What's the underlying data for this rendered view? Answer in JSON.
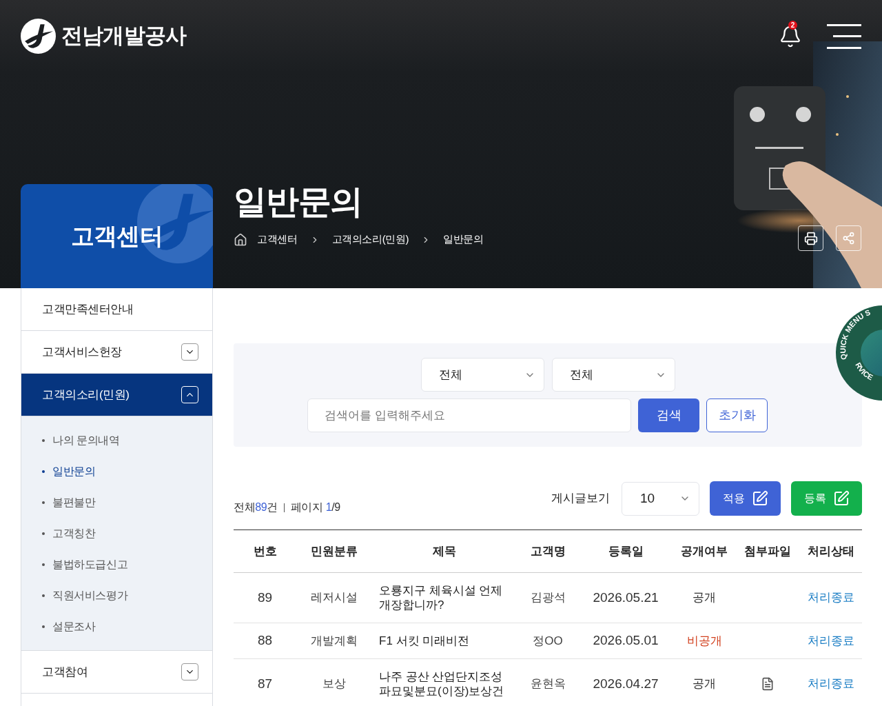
{
  "header": {
    "logo_text": "전남개발공사",
    "notification_count": "2"
  },
  "hero": {
    "section_title": "고객센터",
    "page_title": "일반문의",
    "breadcrumb": [
      "고객센터",
      "고객의소리(민원)",
      "일반문의"
    ]
  },
  "quick_menu": {
    "top_text": "QUICK MENU S",
    "bottom_text": "RVICE"
  },
  "sidebar": {
    "items": [
      {
        "label": "고객만족센터안내",
        "selected": false
      },
      {
        "label": "고객서비스헌장",
        "expanded": false,
        "selected": false
      },
      {
        "label": "고객의소리(민원)",
        "expanded": true,
        "selected": true,
        "children": [
          {
            "label": "나의 문의내역",
            "selected": false
          },
          {
            "label": "일반문의",
            "selected": true
          },
          {
            "label": "불편불만",
            "selected": false
          },
          {
            "label": "고객칭찬",
            "selected": false
          },
          {
            "label": "불법하도급신고",
            "selected": false
          },
          {
            "label": "직원서비스평가",
            "selected": false
          },
          {
            "label": "설문조사",
            "selected": false
          }
        ]
      },
      {
        "label": "고객참여",
        "expanded": false,
        "selected": false
      }
    ]
  },
  "search": {
    "selects": [
      "전체",
      "전체"
    ],
    "placeholder": "검색어를 입력해주세요",
    "search_button": "검색",
    "reset_button": "초기화"
  },
  "list_info": {
    "total_label": "전체",
    "total": "89",
    "total_unit": "건",
    "page_label": "페이지",
    "page": "1",
    "page_total": "/9",
    "page_size_label": "게시글보기",
    "page_size": "10",
    "apply_button": "적용",
    "write_button": "등록"
  },
  "table": {
    "columns": [
      "번호",
      "민원분류",
      "제목",
      "고객명",
      "등록일",
      "공개여부",
      "첨부파일",
      "처리상태"
    ],
    "rows": [
      {
        "no": "89",
        "category": "레저시설",
        "title": "오룡지구 체육시설 언제 개장합니까?",
        "name": "김광석",
        "date": "2026.05.21",
        "visibility": "공개",
        "public": true,
        "attachment": false,
        "status": "처리종료"
      },
      {
        "no": "88",
        "category": "개발계획",
        "title": "F1 서킷 미래비전",
        "name": "정OO",
        "date": "2026.05.01",
        "visibility": "비공개",
        "public": false,
        "attachment": false,
        "status": "처리종료"
      },
      {
        "no": "87",
        "category": "보상",
        "title": "나주 공산 산업단지조성 파묘및분묘(이장)보상건",
        "name": "윤현옥",
        "date": "2026.04.27",
        "visibility": "공개",
        "public": true,
        "attachment": true,
        "status": "처리종료"
      }
    ]
  }
}
